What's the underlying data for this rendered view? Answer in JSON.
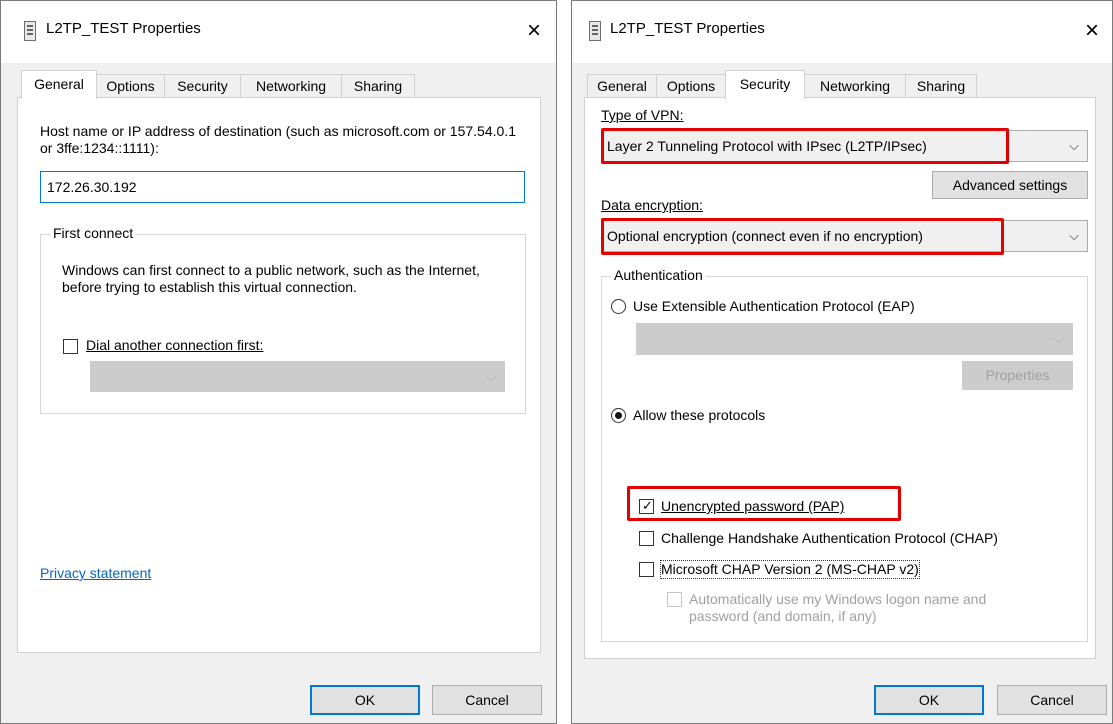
{
  "left_dialog": {
    "title": "L2TP_TEST Properties",
    "close_glyph": "×",
    "tabs": [
      "General",
      "Options",
      "Security",
      "Networking",
      "Sharing"
    ],
    "general": {
      "host_label": "Host name or IP address of destination (such as microsoft.com or 157.54.0.1 or 3ffe:1234::1111):",
      "host_value": "172.26.30.192",
      "first_connect_legend": "First connect",
      "first_connect_desc": "Windows can first connect to a public network, such as the Internet, before trying to establish this virtual connection.",
      "dial_first_label": "Dial another connection first:",
      "dial_first_checked": false,
      "privacy_link": "Privacy statement"
    },
    "ok_label": "OK",
    "cancel_label": "Cancel"
  },
  "right_dialog": {
    "title": "L2TP_TEST Properties",
    "close_glyph": "×",
    "tabs": [
      "General",
      "Options",
      "Security",
      "Networking",
      "Sharing"
    ],
    "security": {
      "vpn_type_label": "Type of VPN:",
      "vpn_type_value": "Layer 2 Tunneling Protocol with IPsec (L2TP/IPsec)",
      "advanced_settings_label": "Advanced settings",
      "encryption_label": "Data encryption:",
      "encryption_value": "Optional encryption (connect even if no encryption)",
      "auth_legend": "Authentication",
      "eap_label": "Use Extensible Authentication Protocol (EAP)",
      "eap_selected": false,
      "properties_label": "Properties",
      "allow_protocols_label": "Allow these protocols",
      "allow_protocols_selected": true,
      "pap_label": "Unencrypted password (PAP)",
      "pap_checked": true,
      "chap_label": "Challenge Handshake Authentication Protocol (CHAP)",
      "chap_checked": false,
      "mschap_label": "Microsoft CHAP Version 2 (MS-CHAP v2)",
      "mschap_checked": false,
      "auto_logon_label": "Automatically use my Windows logon name and password (and domain, if any)",
      "auto_logon_checked": false
    },
    "ok_label": "OK",
    "cancel_label": "Cancel"
  },
  "colors": {
    "highlight": "#e30000",
    "focus_blue": "#0078d7",
    "link": "#0066cc"
  },
  "icons": {
    "check": "✓",
    "chevron": "⌵"
  }
}
